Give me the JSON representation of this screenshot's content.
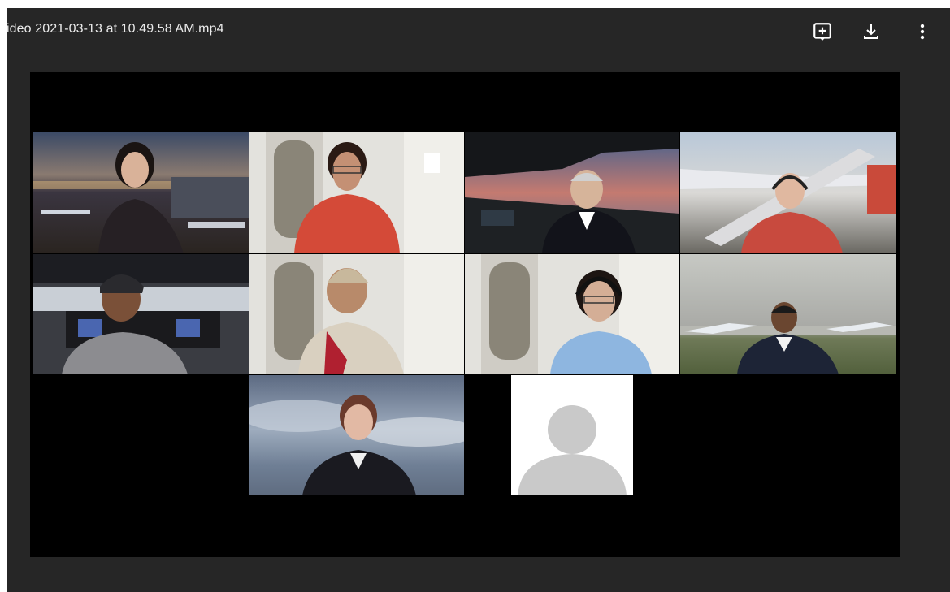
{
  "viewer": {
    "file_name": "ideo 2021-03-13 at 10.49.58 AM.mp4"
  },
  "toolbar": {
    "buttons": [
      {
        "name": "add-to-drive",
        "icon": "add-box-icon"
      },
      {
        "name": "download",
        "icon": "download-icon"
      },
      {
        "name": "more-options",
        "icon": "more-vert-icon"
      }
    ]
  },
  "video_grid": {
    "participants": 10,
    "tiles": [
      {
        "id": "p1",
        "background": "airport-at-dusk"
      },
      {
        "id": "p2",
        "background": "aircraft-door"
      },
      {
        "id": "p3",
        "background": "cockpit-sunset"
      },
      {
        "id": "p4",
        "background": "airplane-stairs"
      },
      {
        "id": "p5",
        "background": "flight-simulator"
      },
      {
        "id": "p6",
        "background": "aircraft-door"
      },
      {
        "id": "p7",
        "background": "aircraft-door"
      },
      {
        "id": "p8",
        "background": "airport-tarmac"
      },
      {
        "id": "p9",
        "background": "cloudy-sky"
      },
      {
        "id": "p10",
        "background": "no-video-avatar"
      }
    ]
  },
  "colors": {
    "viewer_bg": "#262626",
    "video_bg": "#000000",
    "icon": "#ffffff"
  }
}
